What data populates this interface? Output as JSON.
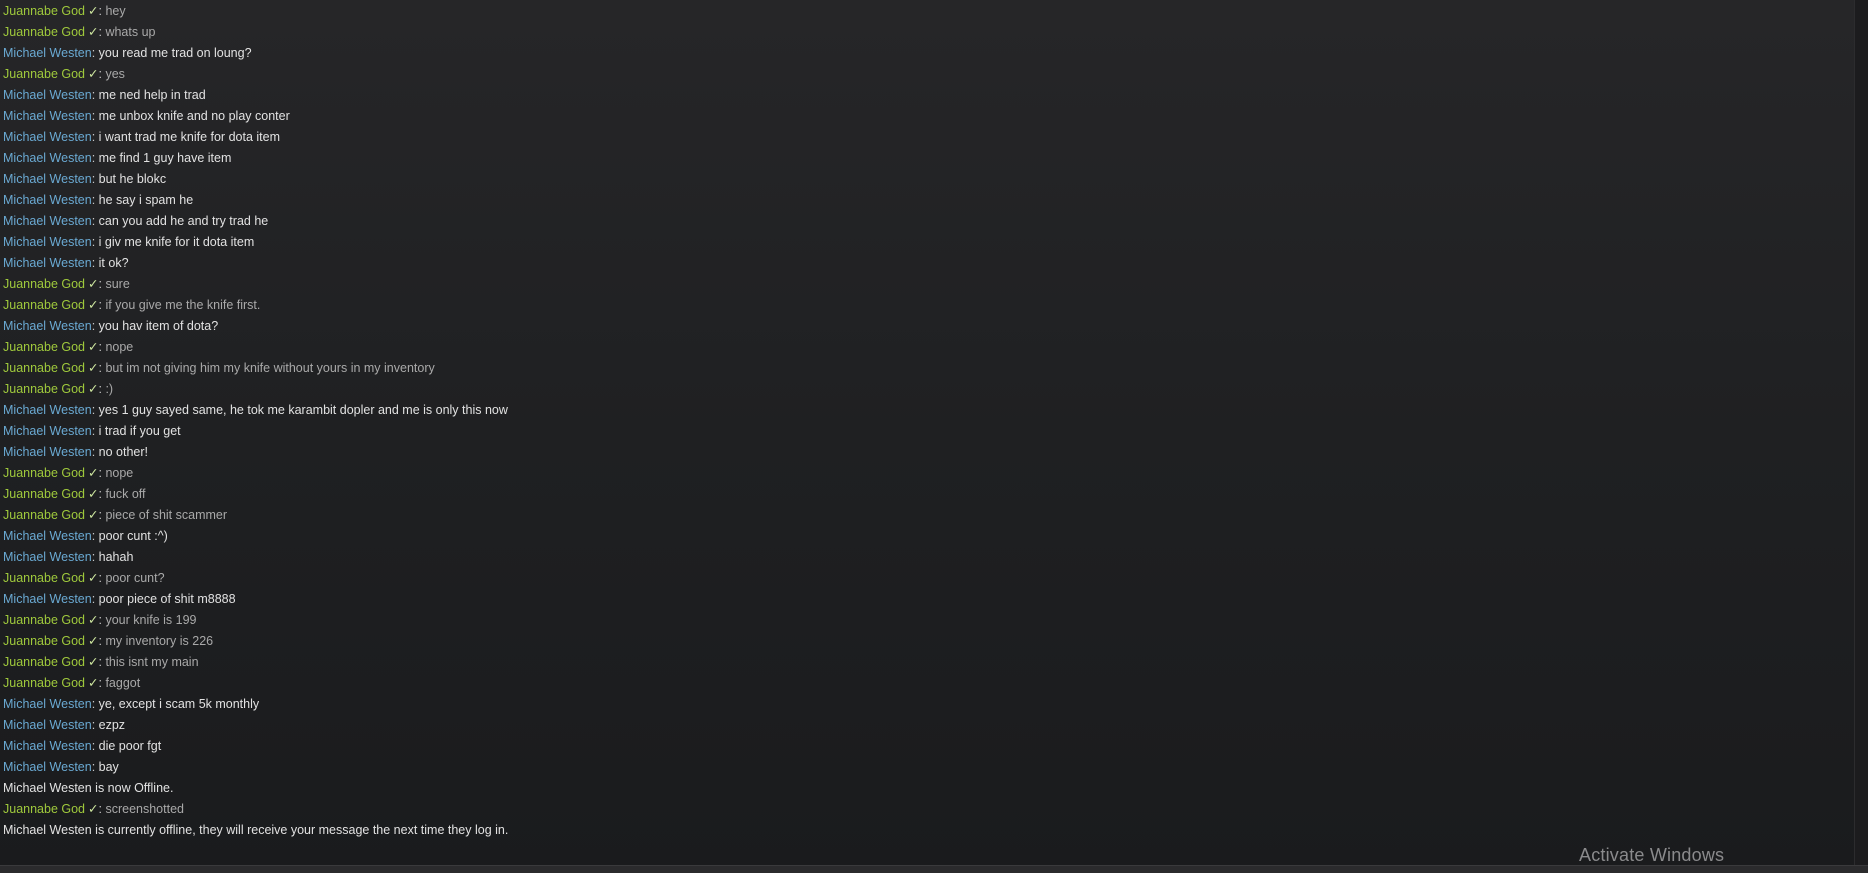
{
  "colors": {
    "friend_name": "#6aa9d2",
    "self_name": "#9fc93c",
    "background": "#202022"
  },
  "names": {
    "self": "Juannabe God",
    "friend": "Michael Westen"
  },
  "messages": [
    {
      "type": "self",
      "name": "Juannabe God",
      "badge": "✓",
      "text": "hey"
    },
    {
      "type": "self",
      "name": "Juannabe God",
      "badge": "✓",
      "text": "whats up"
    },
    {
      "type": "friend",
      "name": "Michael Westen",
      "text": "you read me trad on loung?"
    },
    {
      "type": "self",
      "name": "Juannabe God",
      "badge": "✓",
      "text": "yes"
    },
    {
      "type": "friend",
      "name": "Michael Westen",
      "text": "me ned help in trad"
    },
    {
      "type": "friend",
      "name": "Michael Westen",
      "text": "me unbox knife and no play conter"
    },
    {
      "type": "friend",
      "name": "Michael Westen",
      "text": "i want trad me knife for dota item"
    },
    {
      "type": "friend",
      "name": "Michael Westen",
      "text": "me find 1 guy have item"
    },
    {
      "type": "friend",
      "name": "Michael Westen",
      "text": "but he blokc"
    },
    {
      "type": "friend",
      "name": "Michael Westen",
      "text": "he say i spam he"
    },
    {
      "type": "friend",
      "name": "Michael Westen",
      "text": "can you add he and try trad he"
    },
    {
      "type": "friend",
      "name": "Michael Westen",
      "text": "i giv me knife for it dota item"
    },
    {
      "type": "friend",
      "name": "Michael Westen",
      "text": "it ok?"
    },
    {
      "type": "self",
      "name": "Juannabe God",
      "badge": "✓",
      "text": "sure"
    },
    {
      "type": "self",
      "name": "Juannabe God",
      "badge": "✓",
      "text": "if you give me the knife first."
    },
    {
      "type": "friend",
      "name": "Michael Westen",
      "text": "you hav item of dota?"
    },
    {
      "type": "self",
      "name": "Juannabe God",
      "badge": "✓",
      "text": "nope"
    },
    {
      "type": "self",
      "name": "Juannabe God",
      "badge": "✓",
      "text": "but im not giving him my knife without yours in my inventory"
    },
    {
      "type": "self",
      "name": "Juannabe God",
      "badge": "✓",
      "text": ":)"
    },
    {
      "type": "friend",
      "name": "Michael Westen",
      "text": "yes 1 guy sayed same, he tok me karambit dopler and me is only this now"
    },
    {
      "type": "friend",
      "name": "Michael Westen",
      "text": "i trad if you get"
    },
    {
      "type": "friend",
      "name": "Michael Westen",
      "text": "no other!"
    },
    {
      "type": "self",
      "name": "Juannabe God",
      "badge": "✓",
      "text": "nope"
    },
    {
      "type": "self",
      "name": "Juannabe God",
      "badge": "✓",
      "text": "fuck off"
    },
    {
      "type": "self",
      "name": "Juannabe God",
      "badge": "✓",
      "text": "piece of shit scammer"
    },
    {
      "type": "friend",
      "name": "Michael Westen",
      "text": "poor cunt :^)"
    },
    {
      "type": "friend",
      "name": "Michael Westen",
      "text": "hahah"
    },
    {
      "type": "self",
      "name": "Juannabe God",
      "badge": "✓",
      "text": "poor cunt?"
    },
    {
      "type": "friend",
      "name": "Michael Westen",
      "text": "poor piece of shit m8888"
    },
    {
      "type": "self",
      "name": "Juannabe God",
      "badge": "✓",
      "text": "your knife is 199"
    },
    {
      "type": "self",
      "name": "Juannabe God",
      "badge": "✓",
      "text": "my inventory is 226"
    },
    {
      "type": "self",
      "name": "Juannabe God",
      "badge": "✓",
      "text": "this isnt my main"
    },
    {
      "type": "self",
      "name": "Juannabe God",
      "badge": "✓",
      "text": "faggot"
    },
    {
      "type": "friend",
      "name": "Michael Westen",
      "text": "ye, except i scam 5k monthly"
    },
    {
      "type": "friend",
      "name": "Michael Westen",
      "text": "ezpz"
    },
    {
      "type": "friend",
      "name": "Michael Westen",
      "text": "die poor fgt"
    },
    {
      "type": "friend",
      "name": "Michael Westen",
      "text": "bay"
    },
    {
      "type": "system",
      "text": "Michael Westen is now Offline."
    },
    {
      "type": "self",
      "name": "Juannabe God",
      "badge": "✓",
      "text": "screenshotted"
    },
    {
      "type": "system",
      "text": "Michael Westen is currently offline, they will receive your message the next time they log in."
    }
  ],
  "watermark": "Activate Windows"
}
